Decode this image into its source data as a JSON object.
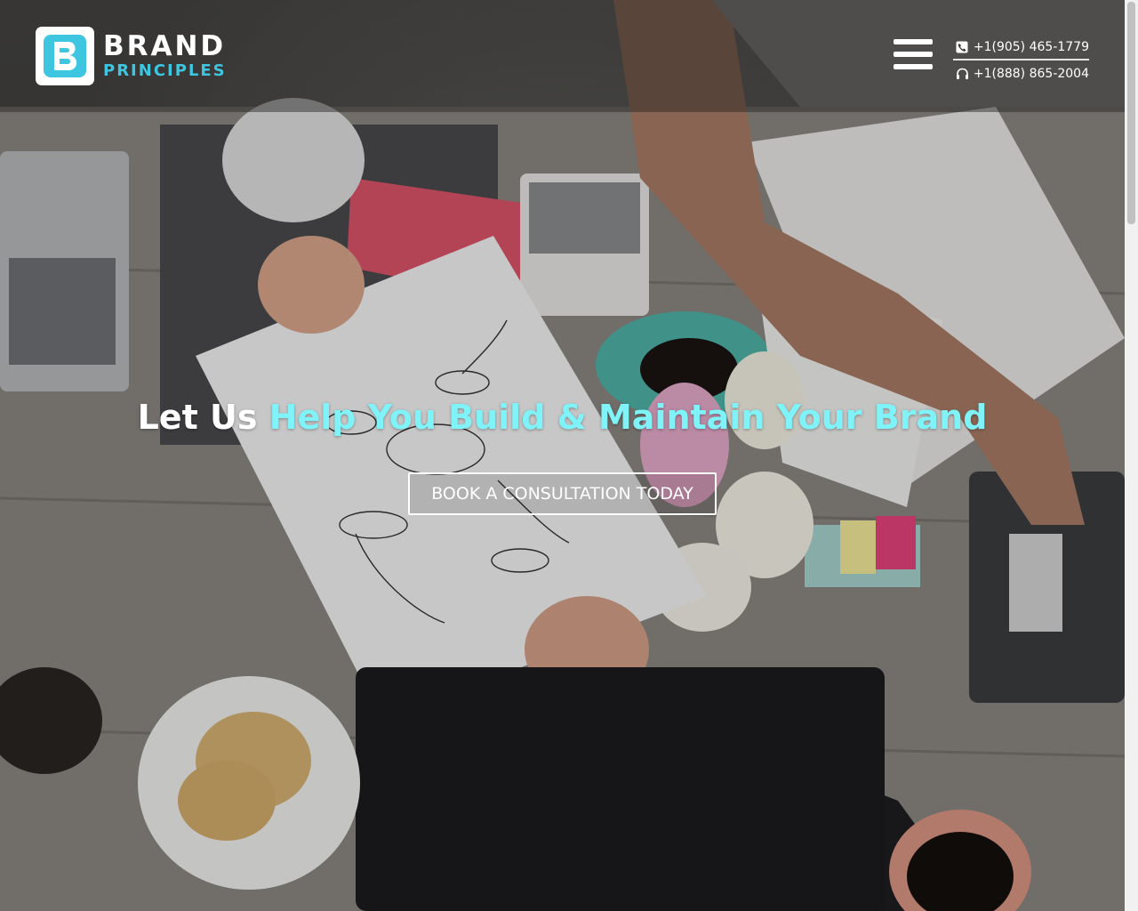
{
  "brand": {
    "name_line1": "BRAND",
    "name_line2": "PRINCIPLES",
    "accent_color": "#3ec6e0"
  },
  "header": {
    "menu_icon": "hamburger-menu-icon",
    "contacts": [
      {
        "icon": "phone-icon",
        "number": "+1(905) 465-1779"
      },
      {
        "icon": "headset-icon",
        "number": "+1(888) 865-2004"
      }
    ]
  },
  "hero": {
    "headline_part1": "Let Us ",
    "headline_part2": "Help You Build & Maintain Your Brand",
    "headline_highlight_color": "#7ff3f8",
    "cta_label": "BOOK A CONSULTATION TODAY",
    "background_image": "office desk with people exchanging brand mind-map paper"
  }
}
